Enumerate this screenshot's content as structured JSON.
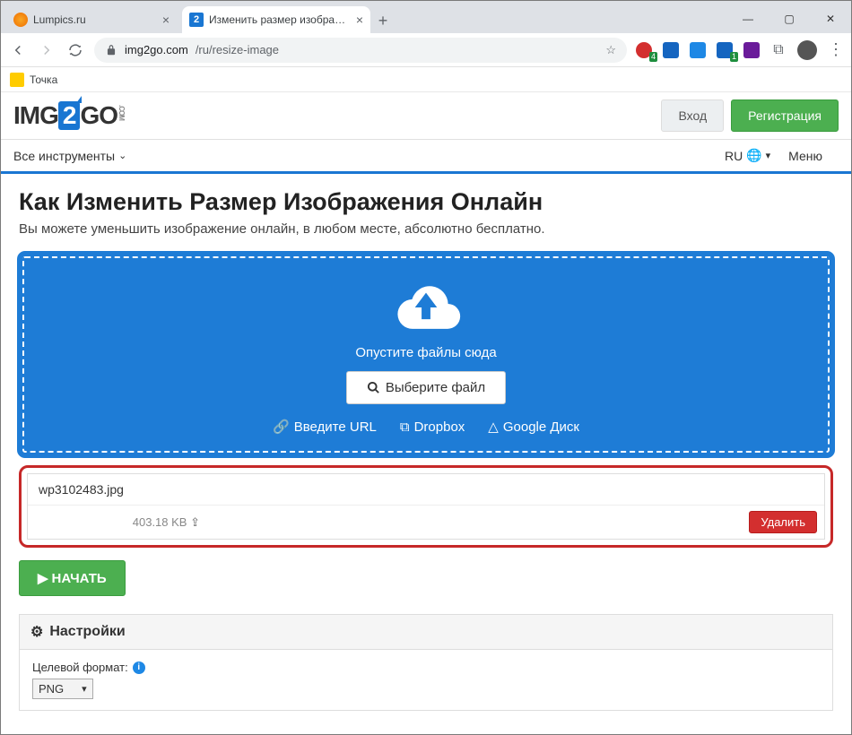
{
  "browser": {
    "tabs": [
      {
        "label": "Lumpics.ru"
      },
      {
        "label": "Изменить размер изображени…"
      }
    ],
    "url_host": "img2go.com",
    "url_path": "/ru/resize-image",
    "ext_badge1": "4",
    "ext_badge2": "1",
    "bookmark": "Точка"
  },
  "page": {
    "logo_pre": "IMG",
    "logo_mid": "2",
    "logo_post": "GO",
    "login": "Вход",
    "register": "Регистрация",
    "tools": "Все инструменты",
    "lang": "RU",
    "menu": "Меню",
    "title": "Как Изменить Размер Изображения Онлайн",
    "subtitle": "Вы можете уменьшить изображение онлайн, в любом месте, абсолютно бесплатно.",
    "drop_text": "Опустите файлы сюда",
    "choose_file": "Выберите файл",
    "url_link": "Введите URL",
    "dropbox": "Dropbox",
    "gdrive": "Google Диск",
    "file_name": "wp3102483.jpg",
    "file_size": "403.18 KB",
    "delete": "Удалить",
    "start": "НАЧАТЬ",
    "settings_hd": "Настройки",
    "target_format": "Целевой формат:",
    "format_value": "PNG"
  }
}
